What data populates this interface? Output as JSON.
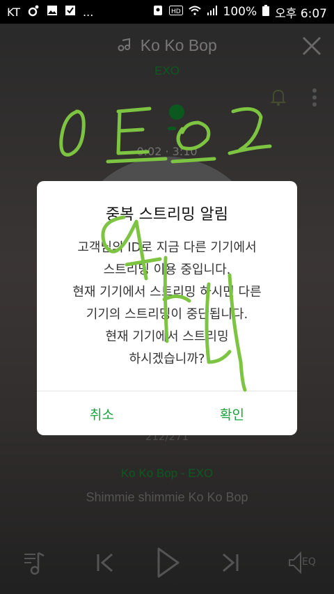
{
  "status_bar": {
    "carrier": "KT",
    "dots": "...",
    "battery": "100%",
    "time": "오후 6:07"
  },
  "player": {
    "song_title": "Ko Ko Bop",
    "artist": "EXO",
    "time": "0:02 · 3:10",
    "track_count": "212/271",
    "now_playing": "Ko Ko Bop - EXO",
    "lyric": "Shimmie shimmie Ko Ko Bop",
    "eq_label": "EQ"
  },
  "dialog": {
    "title": "중복 스트리밍 알림",
    "message_lines": [
      "고객님의 ID로 지금 다른 기기에서",
      "스트리밍 이용 중입니다.",
      "현재 기기에서 스트리밍 하시면 다른",
      "기기의 스트리밍이 중단됩니다.",
      "현재 기기에서 스트리밍",
      "하시겠습니까?"
    ],
    "cancel_label": "취소",
    "confirm_label": "확인"
  },
  "colors": {
    "accent_green": "#1aa33c",
    "scribble_green": "#7dc442"
  },
  "icons": [
    "music-note-icon",
    "close-icon",
    "bell-icon",
    "more-vert-icon",
    "playlist-icon",
    "skip-previous-icon",
    "play-icon",
    "skip-next-icon",
    "eq-icon"
  ]
}
